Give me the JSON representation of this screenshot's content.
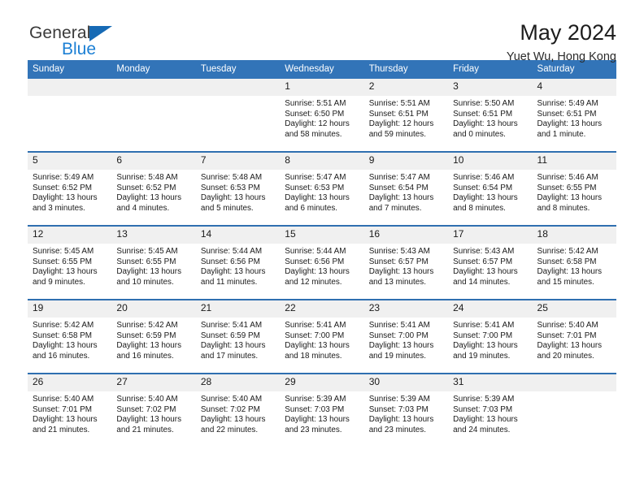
{
  "brand": {
    "name_top": "General",
    "name_bottom": "Blue",
    "accent_color": "#1b7fd4",
    "triangle_color": "#166ab5"
  },
  "header": {
    "title": "May 2024",
    "subtitle": "Yuet Wu, Hong Kong",
    "header_bg": "#3274b8",
    "header_text_color": "#ffffff",
    "row_divider_color": "#2f6fb0",
    "daynum_bg": "#f0f0f0"
  },
  "weekdays": [
    "Sunday",
    "Monday",
    "Tuesday",
    "Wednesday",
    "Thursday",
    "Friday",
    "Saturday"
  ],
  "labels": {
    "sunrise": "Sunrise:",
    "sunset": "Sunset:",
    "daylight": "Daylight:"
  },
  "weeks": [
    [
      {
        "day": "",
        "empty": true
      },
      {
        "day": "",
        "empty": true
      },
      {
        "day": "",
        "empty": true
      },
      {
        "day": "1",
        "sunrise": "Sunrise: 5:51 AM",
        "sunset": "Sunset: 6:50 PM",
        "daylight": "Daylight: 12 hours and 58 minutes."
      },
      {
        "day": "2",
        "sunrise": "Sunrise: 5:51 AM",
        "sunset": "Sunset: 6:51 PM",
        "daylight": "Daylight: 12 hours and 59 minutes."
      },
      {
        "day": "3",
        "sunrise": "Sunrise: 5:50 AM",
        "sunset": "Sunset: 6:51 PM",
        "daylight": "Daylight: 13 hours and 0 minutes."
      },
      {
        "day": "4",
        "sunrise": "Sunrise: 5:49 AM",
        "sunset": "Sunset: 6:51 PM",
        "daylight": "Daylight: 13 hours and 1 minute."
      }
    ],
    [
      {
        "day": "5",
        "sunrise": "Sunrise: 5:49 AM",
        "sunset": "Sunset: 6:52 PM",
        "daylight": "Daylight: 13 hours and 3 minutes."
      },
      {
        "day": "6",
        "sunrise": "Sunrise: 5:48 AM",
        "sunset": "Sunset: 6:52 PM",
        "daylight": "Daylight: 13 hours and 4 minutes."
      },
      {
        "day": "7",
        "sunrise": "Sunrise: 5:48 AM",
        "sunset": "Sunset: 6:53 PM",
        "daylight": "Daylight: 13 hours and 5 minutes."
      },
      {
        "day": "8",
        "sunrise": "Sunrise: 5:47 AM",
        "sunset": "Sunset: 6:53 PM",
        "daylight": "Daylight: 13 hours and 6 minutes."
      },
      {
        "day": "9",
        "sunrise": "Sunrise: 5:47 AM",
        "sunset": "Sunset: 6:54 PM",
        "daylight": "Daylight: 13 hours and 7 minutes."
      },
      {
        "day": "10",
        "sunrise": "Sunrise: 5:46 AM",
        "sunset": "Sunset: 6:54 PM",
        "daylight": "Daylight: 13 hours and 8 minutes."
      },
      {
        "day": "11",
        "sunrise": "Sunrise: 5:46 AM",
        "sunset": "Sunset: 6:55 PM",
        "daylight": "Daylight: 13 hours and 8 minutes."
      }
    ],
    [
      {
        "day": "12",
        "sunrise": "Sunrise: 5:45 AM",
        "sunset": "Sunset: 6:55 PM",
        "daylight": "Daylight: 13 hours and 9 minutes."
      },
      {
        "day": "13",
        "sunrise": "Sunrise: 5:45 AM",
        "sunset": "Sunset: 6:55 PM",
        "daylight": "Daylight: 13 hours and 10 minutes."
      },
      {
        "day": "14",
        "sunrise": "Sunrise: 5:44 AM",
        "sunset": "Sunset: 6:56 PM",
        "daylight": "Daylight: 13 hours and 11 minutes."
      },
      {
        "day": "15",
        "sunrise": "Sunrise: 5:44 AM",
        "sunset": "Sunset: 6:56 PM",
        "daylight": "Daylight: 13 hours and 12 minutes."
      },
      {
        "day": "16",
        "sunrise": "Sunrise: 5:43 AM",
        "sunset": "Sunset: 6:57 PM",
        "daylight": "Daylight: 13 hours and 13 minutes."
      },
      {
        "day": "17",
        "sunrise": "Sunrise: 5:43 AM",
        "sunset": "Sunset: 6:57 PM",
        "daylight": "Daylight: 13 hours and 14 minutes."
      },
      {
        "day": "18",
        "sunrise": "Sunrise: 5:42 AM",
        "sunset": "Sunset: 6:58 PM",
        "daylight": "Daylight: 13 hours and 15 minutes."
      }
    ],
    [
      {
        "day": "19",
        "sunrise": "Sunrise: 5:42 AM",
        "sunset": "Sunset: 6:58 PM",
        "daylight": "Daylight: 13 hours and 16 minutes."
      },
      {
        "day": "20",
        "sunrise": "Sunrise: 5:42 AM",
        "sunset": "Sunset: 6:59 PM",
        "daylight": "Daylight: 13 hours and 16 minutes."
      },
      {
        "day": "21",
        "sunrise": "Sunrise: 5:41 AM",
        "sunset": "Sunset: 6:59 PM",
        "daylight": "Daylight: 13 hours and 17 minutes."
      },
      {
        "day": "22",
        "sunrise": "Sunrise: 5:41 AM",
        "sunset": "Sunset: 7:00 PM",
        "daylight": "Daylight: 13 hours and 18 minutes."
      },
      {
        "day": "23",
        "sunrise": "Sunrise: 5:41 AM",
        "sunset": "Sunset: 7:00 PM",
        "daylight": "Daylight: 13 hours and 19 minutes."
      },
      {
        "day": "24",
        "sunrise": "Sunrise: 5:41 AM",
        "sunset": "Sunset: 7:00 PM",
        "daylight": "Daylight: 13 hours and 19 minutes."
      },
      {
        "day": "25",
        "sunrise": "Sunrise: 5:40 AM",
        "sunset": "Sunset: 7:01 PM",
        "daylight": "Daylight: 13 hours and 20 minutes."
      }
    ],
    [
      {
        "day": "26",
        "sunrise": "Sunrise: 5:40 AM",
        "sunset": "Sunset: 7:01 PM",
        "daylight": "Daylight: 13 hours and 21 minutes."
      },
      {
        "day": "27",
        "sunrise": "Sunrise: 5:40 AM",
        "sunset": "Sunset: 7:02 PM",
        "daylight": "Daylight: 13 hours and 21 minutes."
      },
      {
        "day": "28",
        "sunrise": "Sunrise: 5:40 AM",
        "sunset": "Sunset: 7:02 PM",
        "daylight": "Daylight: 13 hours and 22 minutes."
      },
      {
        "day": "29",
        "sunrise": "Sunrise: 5:39 AM",
        "sunset": "Sunset: 7:03 PM",
        "daylight": "Daylight: 13 hours and 23 minutes."
      },
      {
        "day": "30",
        "sunrise": "Sunrise: 5:39 AM",
        "sunset": "Sunset: 7:03 PM",
        "daylight": "Daylight: 13 hours and 23 minutes."
      },
      {
        "day": "31",
        "sunrise": "Sunrise: 5:39 AM",
        "sunset": "Sunset: 7:03 PM",
        "daylight": "Daylight: 13 hours and 24 minutes."
      },
      {
        "day": "",
        "empty": true
      }
    ]
  ]
}
